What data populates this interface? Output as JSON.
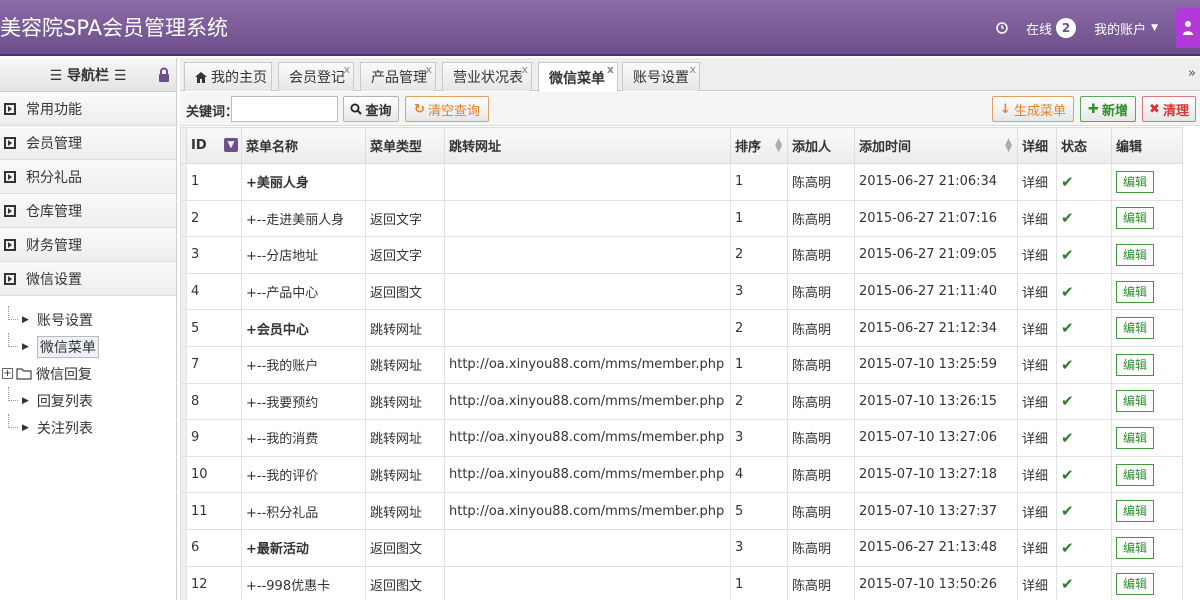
{
  "app": {
    "title": "美容院SPA会员管理系统"
  },
  "header": {
    "online_label": "在线",
    "online_count": "2",
    "account_label": "我的账户"
  },
  "sidebar": {
    "title": "☰ 导航栏 ☰",
    "items": [
      {
        "label": "常用功能"
      },
      {
        "label": "会员管理"
      },
      {
        "label": "积分礼品"
      },
      {
        "label": "仓库管理"
      },
      {
        "label": "财务管理"
      },
      {
        "label": "微信设置"
      }
    ],
    "tree": [
      {
        "label": "账号设置"
      },
      {
        "label": "微信菜单"
      },
      {
        "label": "微信回复"
      },
      {
        "label": "回复列表"
      },
      {
        "label": "关注列表"
      }
    ]
  },
  "tabs": [
    {
      "label": "我的主页"
    },
    {
      "label": "会员登记"
    },
    {
      "label": "产品管理"
    },
    {
      "label": "营业状况表"
    },
    {
      "label": "微信菜单"
    },
    {
      "label": "账号设置"
    }
  ],
  "toolbar": {
    "keyword_label": "关键词：",
    "keyword_value": "",
    "query_label": "查询",
    "clear_label": "清空查询",
    "generate_label": "生成菜单",
    "add_label": "新增",
    "purge_label": "清理"
  },
  "table": {
    "headers": [
      "ID",
      "菜单名称",
      "菜单类型",
      "跳转网址",
      "排序",
      "添加人",
      "添加时间",
      "详细",
      "状态",
      "编辑"
    ],
    "detail_text": "详细",
    "edit_text": "编辑",
    "rows": [
      {
        "id": "1",
        "name": "+美丽人身",
        "type": "",
        "url": "",
        "sort": "1",
        "adder": "陈高明",
        "time": "2015-06-27 21:06:34",
        "parent": true
      },
      {
        "id": "2",
        "name": "+--走进美丽人身",
        "type": "返回文字",
        "url": "",
        "sort": "1",
        "adder": "陈高明",
        "time": "2015-06-27 21:07:16",
        "parent": false
      },
      {
        "id": "3",
        "name": "+--分店地址",
        "type": "返回文字",
        "url": "",
        "sort": "2",
        "adder": "陈高明",
        "time": "2015-06-27 21:09:05",
        "parent": false
      },
      {
        "id": "4",
        "name": "+--产品中心",
        "type": "返回图文",
        "url": "",
        "sort": "3",
        "adder": "陈高明",
        "time": "2015-06-27 21:11:40",
        "parent": false
      },
      {
        "id": "5",
        "name": "+会员中心",
        "type": "跳转网址",
        "url": "",
        "sort": "2",
        "adder": "陈高明",
        "time": "2015-06-27 21:12:34",
        "parent": true
      },
      {
        "id": "7",
        "name": "+--我的账户",
        "type": "跳转网址",
        "url": "http://oa.xinyou88.com/mms/member.php",
        "sort": "1",
        "adder": "陈高明",
        "time": "2015-07-10 13:25:59",
        "parent": false
      },
      {
        "id": "8",
        "name": "+--我要预约",
        "type": "跳转网址",
        "url": "http://oa.xinyou88.com/mms/member.php",
        "sort": "2",
        "adder": "陈高明",
        "time": "2015-07-10 13:26:15",
        "parent": false
      },
      {
        "id": "9",
        "name": "+--我的消费",
        "type": "跳转网址",
        "url": "http://oa.xinyou88.com/mms/member.php",
        "sort": "3",
        "adder": "陈高明",
        "time": "2015-07-10 13:27:06",
        "parent": false
      },
      {
        "id": "10",
        "name": "+--我的评价",
        "type": "跳转网址",
        "url": "http://oa.xinyou88.com/mms/member.php",
        "sort": "4",
        "adder": "陈高明",
        "time": "2015-07-10 13:27:18",
        "parent": false
      },
      {
        "id": "11",
        "name": "+--积分礼品",
        "type": "跳转网址",
        "url": "http://oa.xinyou88.com/mms/member.php",
        "sort": "5",
        "adder": "陈高明",
        "time": "2015-07-10 13:27:37",
        "parent": false
      },
      {
        "id": "6",
        "name": "+最新活动",
        "type": "返回图文",
        "url": "",
        "sort": "3",
        "adder": "陈高明",
        "time": "2015-06-27 21:13:48",
        "parent": true
      },
      {
        "id": "12",
        "name": "+--998优惠卡",
        "type": "返回图文",
        "url": "",
        "sort": "1",
        "adder": "陈高明",
        "time": "2015-07-10 13:50:26",
        "parent": false
      }
    ]
  }
}
